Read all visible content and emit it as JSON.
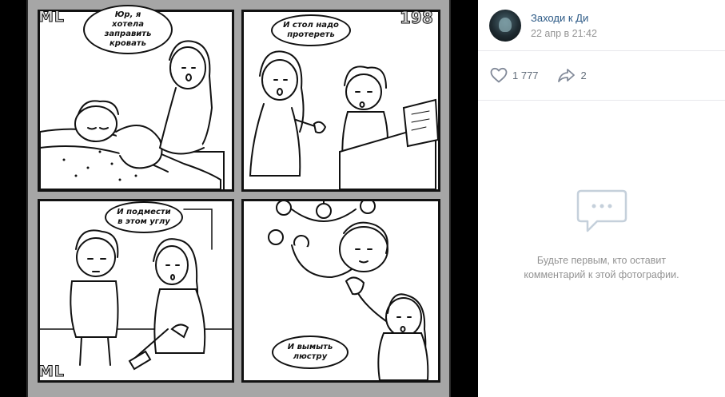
{
  "comic": {
    "tag_left": "ML",
    "tag_bottom": "ML",
    "page_number": "198",
    "bubbles": {
      "p1": "Юр, я\nхотела заправить\nкровать",
      "p2": "И стол надо\nпротереть",
      "p3": "И подмести\nв этом углу",
      "p4": "И вымыть\nлюстру"
    }
  },
  "post": {
    "author": "Заходи к Ди",
    "date": "22 апр в 21:42",
    "likes": "1 777",
    "shares": "2"
  },
  "comments": {
    "empty_text": "Будьте первым, кто оставит\nкомментарий к этой фотографии."
  },
  "icons": {
    "like": "heart-icon",
    "share": "share-arrow-icon",
    "empty": "comment-bubble-icon"
  },
  "colors": {
    "link": "#2a5885",
    "muted": "#939393",
    "icon": "#828a99",
    "viewer_bg": "#000000"
  }
}
